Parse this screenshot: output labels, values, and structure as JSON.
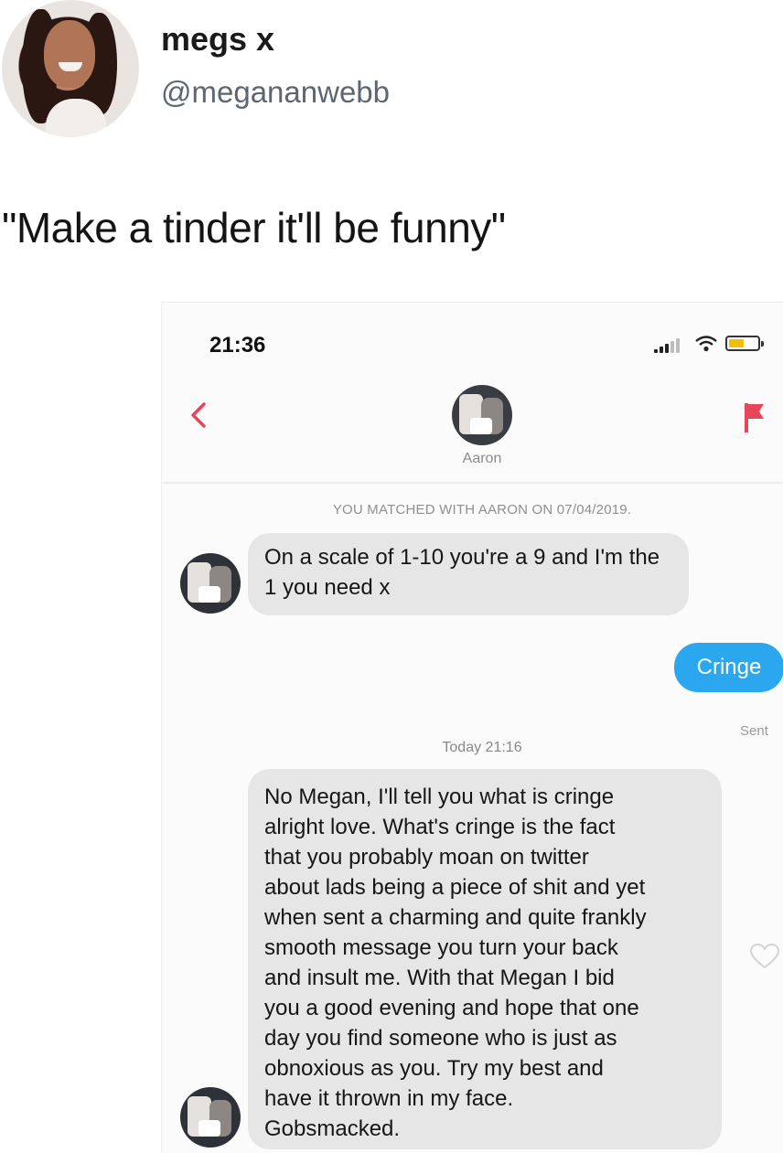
{
  "tweet": {
    "name": "megs x",
    "handle": "@megananwebb",
    "text": "\"Make a tinder it'll be funny\""
  },
  "phone": {
    "status_time": "21:36",
    "match_name": "Aaron",
    "match_info": "YOU MATCHED WITH AARON ON 07/04/2019.",
    "messages": [
      {
        "from": "Aaron",
        "text": "On a scale of 1-10 you're a 9 and I'm the 1 you need x"
      },
      {
        "from": "me",
        "text": "Cringe",
        "status": "Sent"
      },
      {
        "timestamp": "Today 21:16"
      },
      {
        "from": "Aaron",
        "text": "No Megan, I'll tell you what is cringe\nalright love.  What's cringe is the fact\nthat you probably moan on twitter\nabout lads being a piece of shit and yet\nwhen sent a charming and quite frankly\nsmooth message you turn your back\nand insult me. With that Megan I bid\nyou a good evening and hope that one\nday you find someone who is just as\nobnoxious as you. Try my best and\nhave it thrown in my face.\nGobsmacked."
      }
    ],
    "icons": {
      "back": "chevron-left-icon",
      "report": "flag-icon",
      "like": "heart-icon"
    },
    "colors": {
      "accent": "#e8445a",
      "sent_bubble": "#2aa7ef",
      "received_bubble": "#e6e6e7"
    }
  }
}
